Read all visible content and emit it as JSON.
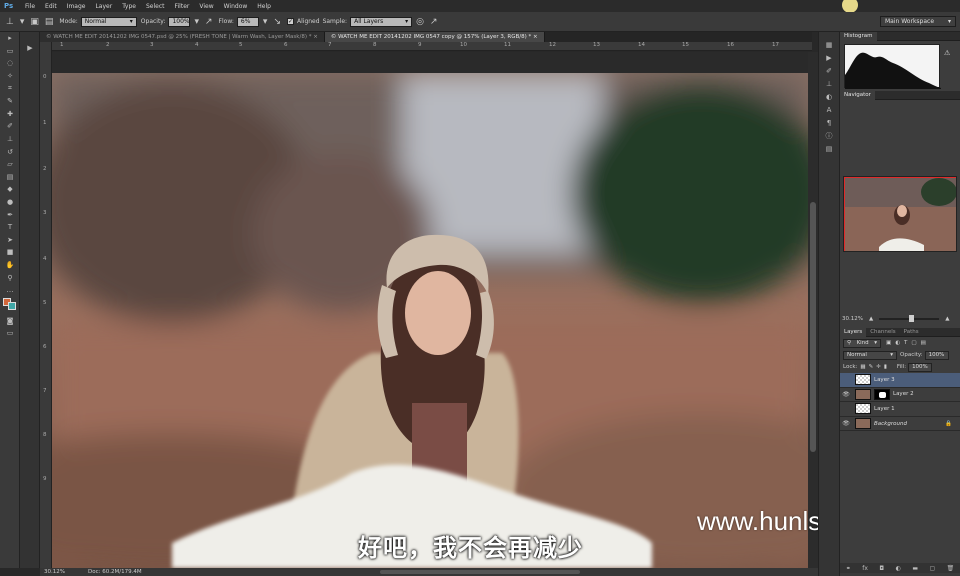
{
  "app": {
    "logo": "Ps"
  },
  "menu": [
    "File",
    "Edit",
    "Image",
    "Layer",
    "Type",
    "Select",
    "Filter",
    "View",
    "Window",
    "Help"
  ],
  "options": {
    "mode_label": "Mode:",
    "mode_value": "Normal",
    "opacity_label": "Opacity:",
    "opacity_value": "100%",
    "flow_label": "Flow:",
    "flow_value": "6%",
    "aligned_label": "Aligned",
    "sample_label": "Sample:",
    "sample_value": "All Layers",
    "workspace": "Main Workspace"
  },
  "doc_tabs": [
    {
      "label": "© WATCH ME EDIT 20141202 IMG 0547.psd @ 25% (FRESH TONE | Warm Wash, Layer Mask/8) * ×"
    },
    {
      "label": "© WATCH ME EDIT 20141202 IMG 0547 copy @ 157% (Layer 3, RGB/8) * ×"
    }
  ],
  "ruler_top": [
    "1",
    "2",
    "3",
    "4",
    "5",
    "6",
    "7",
    "8",
    "9",
    "10",
    "11",
    "12",
    "13",
    "14",
    "15",
    "16",
    "17"
  ],
  "ruler_left": [
    "0",
    "1",
    "2",
    "3",
    "4",
    "5",
    "6",
    "7",
    "8",
    "9"
  ],
  "status": {
    "zoom": "30.12%",
    "doc": "Doc: 60.2M/179.4M"
  },
  "subtitle": "好吧，我不会再减少",
  "watermark": "www.hunls.com",
  "panels": {
    "histogram_tab": "Histogram",
    "navigator_tab": "Navigator",
    "nav_zoom": "30.12%",
    "layers_tabs": [
      "Layers",
      "Channels",
      "Paths"
    ],
    "kind_label": "Kind",
    "blend_mode": "Normal",
    "opacity_label": "Opacity:",
    "opacity_value": "100%",
    "lock_label": "Lock:",
    "fill_label": "Fill:",
    "fill_value": "100%",
    "layers": [
      {
        "name": "Layer 3",
        "visible": false,
        "selected": true
      },
      {
        "name": "Layer 2",
        "visible": true,
        "selected": false
      },
      {
        "name": "Layer 1",
        "visible": false,
        "selected": false
      },
      {
        "name": "Background",
        "visible": true,
        "selected": false
      }
    ]
  },
  "colors": {
    "foreground": "#d0673b",
    "background": "#3fa6a6",
    "panel_selected": "#4b5d7a"
  },
  "icons": {
    "options": [
      "clone-stamp-icon",
      "brush-preset-icon",
      "toggle-brush-panel-icon",
      "clone-source-icon",
      "airbrush-icon",
      "ignore-adjustment-icon",
      "pressure-icon"
    ]
  }
}
